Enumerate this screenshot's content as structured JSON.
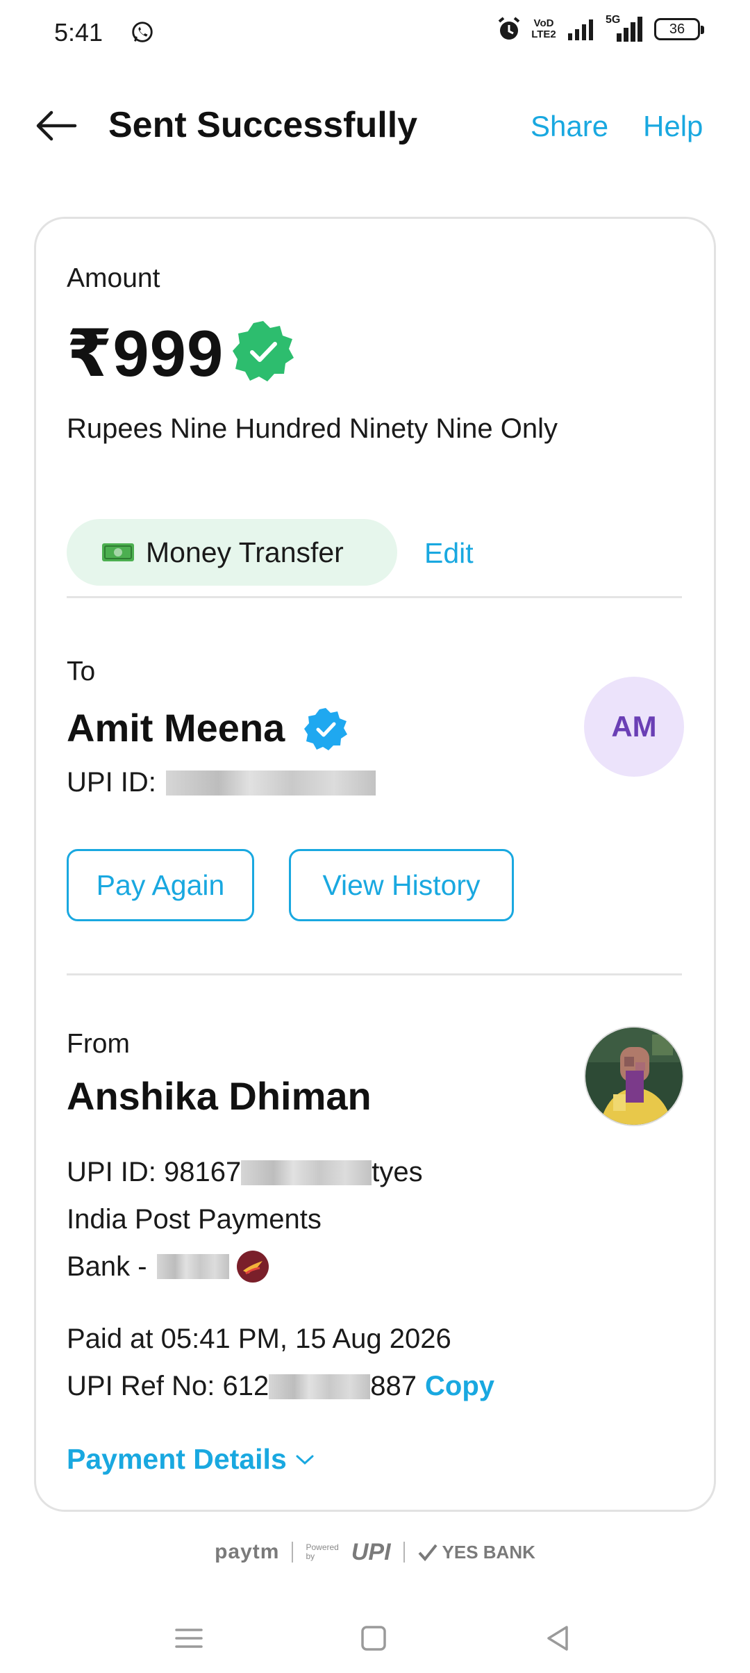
{
  "status_bar": {
    "time": "5:41",
    "volte_top": "VoD",
    "volte_bottom": "LTE2",
    "network": "5G",
    "battery": "36"
  },
  "header": {
    "title": "Sent Successfully",
    "share_label": "Share",
    "help_label": "Help"
  },
  "amount": {
    "label": "Amount",
    "value": "₹999",
    "words": "Rupees Nine Hundred Ninety Nine Only",
    "category": "Money Transfer",
    "edit_label": "Edit"
  },
  "to": {
    "label": "To",
    "name": "Amit Meena",
    "upi_label": "UPI ID:",
    "initials": "AM",
    "pay_again_label": "Pay Again",
    "view_history_label": "View History"
  },
  "from": {
    "label": "From",
    "name": "Anshika Dhiman",
    "upi_prefix": "UPI ID: 98167",
    "upi_suffix": "tyes",
    "bank_line1": "India Post Payments",
    "bank_line2": "Bank -"
  },
  "transaction": {
    "paid_at": "Paid at 05:41 PM, 15 Aug 2026",
    "ref_prefix": "UPI Ref No: 612",
    "ref_suffix": "887",
    "copy_label": "Copy",
    "details_label": "Payment Details"
  },
  "footer": {
    "paytm": "paytm",
    "powered_line1": "Powered",
    "powered_line2": "by",
    "upi": "UPI",
    "bank": "YES BANK"
  },
  "colors": {
    "accent": "#19a8e0",
    "verified_green": "#2dbd6e",
    "verified_blue": "#1fa8f0",
    "chip_bg": "#e6f6ec",
    "avatar_bg": "#ece3fb",
    "avatar_text": "#6a3fb5"
  }
}
